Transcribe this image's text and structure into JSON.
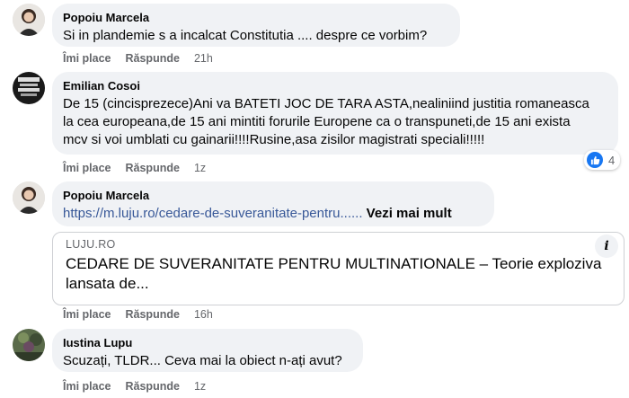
{
  "comments": [
    {
      "author": "Popoiu Marcela",
      "text": "Si in plandemie s a incalcat Constitutia .... despre ce vorbim?",
      "like_label": "Îmi place",
      "reply_label": "Răspunde",
      "time": "21h"
    },
    {
      "author": "Emilian Cosoi",
      "text_lines": [
        "De 15 (cincisprezece)Ani va BATETI JOC DE TARA ASTA,nealiniind justitia romaneasca",
        "la cea europeana,de 15 ani mintiti forurile Europene ca o transpuneti,de 15 ani exista",
        "mcv si voi umblati cu gainarii!!!!Rusine,asa zisilor magistrati speciali!!!!!"
      ],
      "like_label": "Îmi place",
      "reply_label": "Răspunde",
      "time": "1z",
      "reaction_count": "4"
    },
    {
      "author": "Popoiu Marcela",
      "link_text": "https://m.luju.ro/cedare-de-suveranitate-pentru......",
      "more_label": "Vezi mai mult",
      "preview": {
        "domain": "LUJU.RO",
        "title_lines": [
          "CEDARE DE SUVERANITATE PENTRU MULTINATIONALE – Teorie exploziva",
          "lansata de..."
        ]
      },
      "like_label": "Îmi place",
      "reply_label": "Răspunde",
      "time": "16h"
    },
    {
      "author": "Iustina Lupu",
      "text": "Scuzați, TLDR... Ceva mai la obiect n-ați avut?",
      "like_label": "Îmi place",
      "reply_label": "Răspunde",
      "time": "1z"
    }
  ],
  "icons": {
    "like": "like-thumb-icon",
    "info": "info-icon"
  },
  "colors": {
    "bubble": "#f0f2f5",
    "link": "#385898",
    "meta": "#65676b",
    "like": "#1877f2"
  }
}
